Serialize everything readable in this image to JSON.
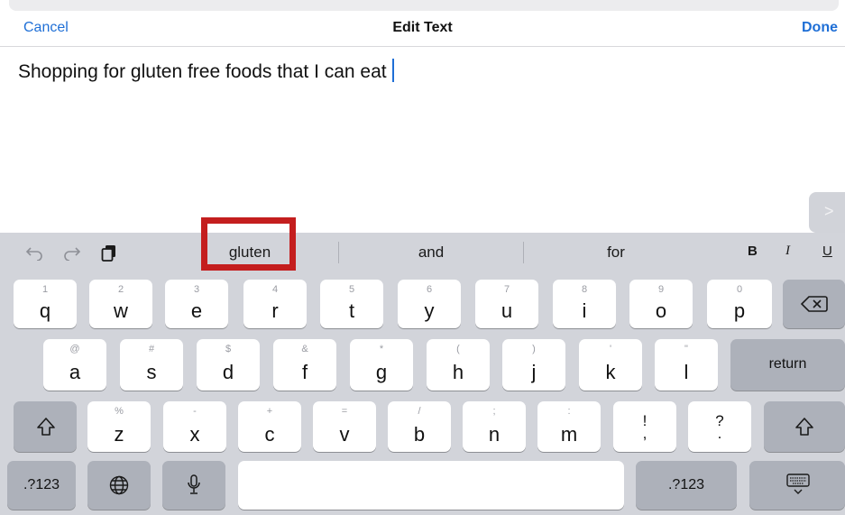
{
  "navbar": {
    "cancel": "Cancel",
    "title": "Edit Text",
    "done": "Done"
  },
  "editor": {
    "text": "Shopping for gluten free foods that I can eat"
  },
  "side_arrow": {
    "glyph": ">"
  },
  "toolbar": {
    "undo_icon": "undo-icon",
    "redo_icon": "redo-icon",
    "paste_icon": "paste-icon"
  },
  "suggestions": [
    "gluten",
    "and",
    "for"
  ],
  "highlighted_suggestion": "gluten",
  "format": {
    "bold": "B",
    "italic": "I",
    "underline": "U"
  },
  "colors": {
    "accent": "#1f6fd6",
    "highlight": "#c41e1e",
    "keyboard_bg": "#d2d4da"
  },
  "keyboard": {
    "row1": [
      {
        "main": "q",
        "sub": "1"
      },
      {
        "main": "w",
        "sub": "2"
      },
      {
        "main": "e",
        "sub": "3"
      },
      {
        "main": "r",
        "sub": "4"
      },
      {
        "main": "t",
        "sub": "5"
      },
      {
        "main": "y",
        "sub": "6"
      },
      {
        "main": "u",
        "sub": "7"
      },
      {
        "main": "i",
        "sub": "8"
      },
      {
        "main": "o",
        "sub": "9"
      },
      {
        "main": "p",
        "sub": "0"
      }
    ],
    "row2": [
      {
        "main": "a",
        "sub": "@"
      },
      {
        "main": "s",
        "sub": "#"
      },
      {
        "main": "d",
        "sub": "$"
      },
      {
        "main": "f",
        "sub": "&"
      },
      {
        "main": "g",
        "sub": "*"
      },
      {
        "main": "h",
        "sub": "("
      },
      {
        "main": "j",
        "sub": ")"
      },
      {
        "main": "k",
        "sub": "'"
      },
      {
        "main": "l",
        "sub": "\""
      }
    ],
    "row3": [
      {
        "main": "z",
        "sub": "%"
      },
      {
        "main": "x",
        "sub": "-"
      },
      {
        "main": "c",
        "sub": "+"
      },
      {
        "main": "v",
        "sub": "="
      },
      {
        "main": "b",
        "sub": "/"
      },
      {
        "main": "n",
        "sub": ";"
      },
      {
        "main": "m",
        "sub": ":"
      }
    ],
    "punct": [
      {
        "main": "!",
        "alt": ","
      },
      {
        "main": "?",
        "alt": "."
      }
    ],
    "return_label": "return",
    "numbers_label": ".?123",
    "backspace_icon": "backspace-icon",
    "shift_icon": "shift-icon",
    "globe_icon": "globe-icon",
    "mic_icon": "microphone-icon",
    "dismiss_icon": "keyboard-dismiss-icon"
  }
}
